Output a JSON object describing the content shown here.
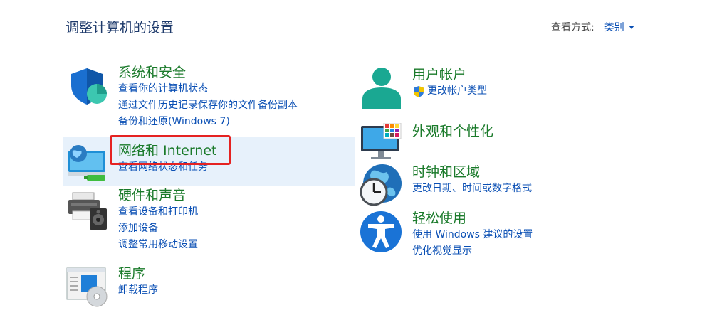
{
  "header": {
    "title": "调整计算机的设置",
    "view_by_label": "查看方式:",
    "view_by_value": "类别"
  },
  "categories": [
    {
      "id": "system-security",
      "title": "系统和安全",
      "links": [
        "查看你的计算机状态",
        "通过文件历史记录保存你的文件备份副本",
        "备份和还原(Windows 7)"
      ],
      "icon": "shield-icon"
    },
    {
      "id": "network-internet",
      "title": "网络和 Internet",
      "links": [
        "查看网络状态和任务"
      ],
      "icon": "network-globe-icon",
      "highlighted": true
    },
    {
      "id": "hardware-sound",
      "title": "硬件和声音",
      "links": [
        "查看设备和打印机",
        "添加设备",
        "调整常用移动设置"
      ],
      "icon": "printer-speaker-icon"
    },
    {
      "id": "programs",
      "title": "程序",
      "links": [
        "卸载程序"
      ],
      "icon": "programs-disc-icon"
    },
    {
      "id": "user-accounts",
      "title": "用户帐户",
      "links": [
        "更改帐户类型"
      ],
      "icon": "user-icon",
      "link_icons": [
        "uac-shield-icon"
      ]
    },
    {
      "id": "appearance",
      "title": "外观和个性化",
      "links": [],
      "icon": "monitor-palette-icon"
    },
    {
      "id": "clock-region",
      "title": "时钟和区域",
      "links": [
        "更改日期、时间或数字格式"
      ],
      "icon": "globe-clock-icon"
    },
    {
      "id": "ease-of-access",
      "title": "轻松使用",
      "links": [
        "使用 Windows 建议的设置",
        "优化视觉显示"
      ],
      "icon": "accessibility-icon"
    }
  ],
  "colors": {
    "title_green": "#1a7a2a",
    "link_blue": "#0a4fb4",
    "highlight": "#e7f1fb",
    "annotation_red": "#e52221"
  }
}
